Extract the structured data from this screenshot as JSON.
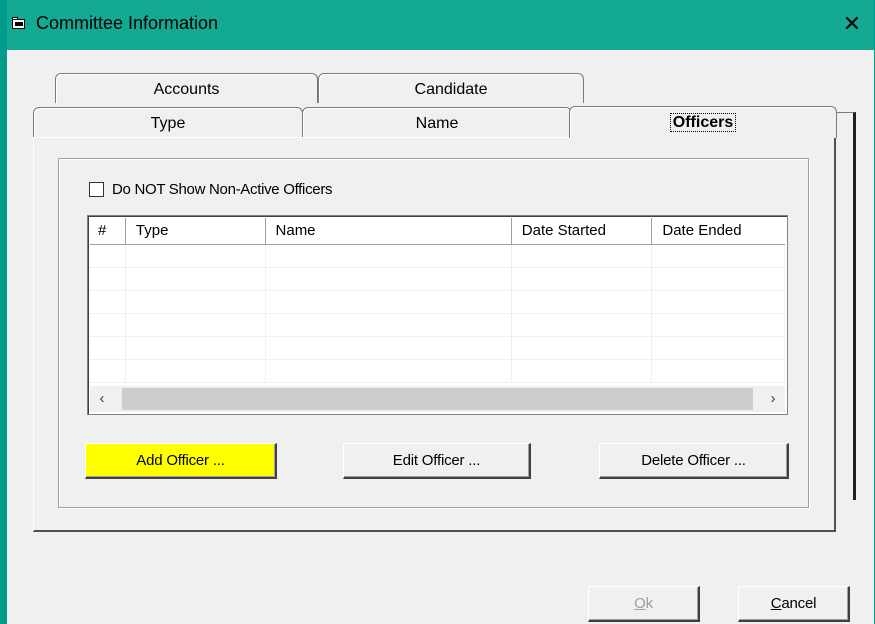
{
  "window": {
    "title": "Committee Information",
    "close_glyph": "✕",
    "icon": "folder-icon"
  },
  "tabs": {
    "back_row": [
      {
        "label": "Accounts"
      },
      {
        "label": "Candidate"
      }
    ],
    "front_row": [
      {
        "label": "Type"
      },
      {
        "label": "Name"
      },
      {
        "label": "Officers",
        "active": true
      }
    ]
  },
  "officers": {
    "checkbox_label": "Do NOT Show Non-Active Officers",
    "checkbox_checked": false,
    "columns": [
      "#",
      "Type",
      "Name",
      "Date Started",
      "Date Ended"
    ],
    "rows": [],
    "scroll_left": "‹",
    "scroll_right": "›",
    "add_button": "Add Officer ...",
    "edit_button": "Edit Officer ...",
    "delete_button": "Delete Officer ..."
  },
  "footer": {
    "ok_mnemonic": "O",
    "ok_rest": "k",
    "cancel_mnemonic": "C",
    "cancel_rest": "ancel"
  },
  "colors": {
    "titlebar": "#13a993",
    "highlight_button": "#ffff00"
  }
}
